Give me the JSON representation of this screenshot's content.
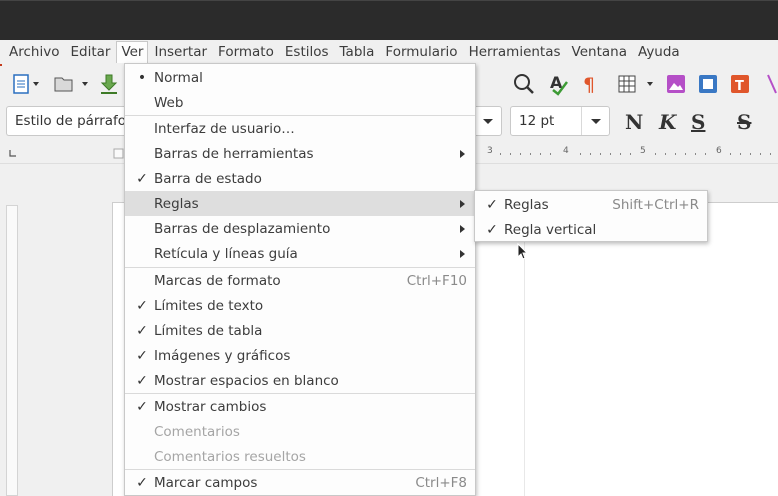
{
  "menubar": [
    "Archivo",
    "Editar",
    "Ver",
    "Insertar",
    "Formato",
    "Estilos",
    "Tabla",
    "Formulario",
    "Herramientas",
    "Ventana",
    "Ayuda"
  ],
  "toolbar2": {
    "paragraph_style": "Estilo de párrafo",
    "font_size": "12 pt",
    "bold_label": "N",
    "italic_label": "K",
    "underline_label": "S",
    "strike_label": "S"
  },
  "ruler": {
    "ticks": [
      "3",
      "4",
      "5",
      "6"
    ]
  },
  "view_menu": {
    "items": [
      {
        "label": "Normal",
        "mark": "•",
        "shortcut": "",
        "submenu": false,
        "disabled": false
      },
      {
        "label": "Web",
        "mark": "",
        "shortcut": "",
        "submenu": false,
        "disabled": false
      },
      {
        "label": "Interfaz de usuario…",
        "mark": "",
        "shortcut": "",
        "submenu": false,
        "disabled": false
      },
      {
        "label": "Barras de herramientas",
        "mark": "",
        "shortcut": "",
        "submenu": true,
        "disabled": false
      },
      {
        "label": "Barra de estado",
        "mark": "✓",
        "shortcut": "",
        "submenu": false,
        "disabled": false
      },
      {
        "label": "Reglas",
        "mark": "",
        "shortcut": "",
        "submenu": true,
        "disabled": false
      },
      {
        "label": "Barras de desplazamiento",
        "mark": "",
        "shortcut": "",
        "submenu": true,
        "disabled": false
      },
      {
        "label": "Retícula y líneas guía",
        "mark": "",
        "shortcut": "",
        "submenu": true,
        "disabled": false
      },
      {
        "label": "Marcas de formato",
        "mark": "",
        "shortcut": "Ctrl+F10",
        "submenu": false,
        "disabled": false
      },
      {
        "label": "Límites de texto",
        "mark": "✓",
        "shortcut": "",
        "submenu": false,
        "disabled": false
      },
      {
        "label": "Límites de tabla",
        "mark": "✓",
        "shortcut": "",
        "submenu": false,
        "disabled": false
      },
      {
        "label": "Imágenes y gráficos",
        "mark": "✓",
        "shortcut": "",
        "submenu": false,
        "disabled": false
      },
      {
        "label": "Mostrar espacios en blanco",
        "mark": "✓",
        "shortcut": "",
        "submenu": false,
        "disabled": false
      },
      {
        "label": "Mostrar cambios",
        "mark": "✓",
        "shortcut": "",
        "submenu": false,
        "disabled": false
      },
      {
        "label": "Comentarios",
        "mark": "",
        "shortcut": "",
        "submenu": false,
        "disabled": true
      },
      {
        "label": "Comentarios resueltos",
        "mark": "",
        "shortcut": "",
        "submenu": false,
        "disabled": true
      },
      {
        "label": "Marcar campos",
        "mark": "✓",
        "shortcut": "Ctrl+F8",
        "submenu": false,
        "disabled": false
      }
    ]
  },
  "rulers_submenu": {
    "items": [
      {
        "label": "Reglas",
        "mark": "✓",
        "shortcut": "Shift+Ctrl+R"
      },
      {
        "label": "Regla vertical",
        "mark": "✓",
        "shortcut": ""
      }
    ]
  }
}
